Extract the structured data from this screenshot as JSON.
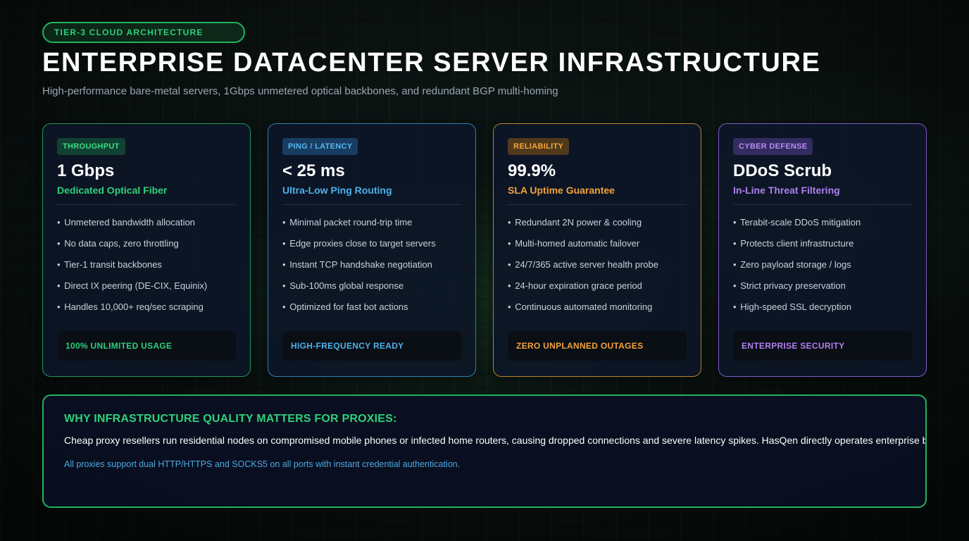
{
  "header": {
    "tag": "TIER-3 CLOUD ARCHITECTURE",
    "title": "ENTERPRISE DATACENTER SERVER INFRASTRUCTURE",
    "subtitle": "High-performance bare-metal servers, 1Gbps unmetered optical backbones, and redundant BGP multi-homing"
  },
  "colors": {
    "green": "#2fd07a",
    "blue": "#4fb0ea",
    "orange": "#f2a33a",
    "purple": "#b17ff0",
    "card_bg": "#0c1628",
    "page_bg": "#0a1311"
  },
  "cards": [
    {
      "tag": "THROUGHPUT",
      "metric": "1 Gbps",
      "metric_sub": "Dedicated Optical Fiber",
      "bullets": [
        "Unmetered bandwidth allocation",
        "No data caps, zero throttling",
        "Tier-1 transit backbones",
        "Direct IX peering (DE-CIX, Equinix)",
        "Handles 10,000+ req/sec scraping"
      ],
      "footer": "100% UNLIMITED USAGE"
    },
    {
      "tag": "PING / LATENCY",
      "metric": "< 25 ms",
      "metric_sub": "Ultra-Low Ping Routing",
      "bullets": [
        "Minimal packet round-trip time",
        "Edge proxies close to target servers",
        "Instant TCP handshake negotiation",
        "Sub-100ms global response",
        "Optimized for fast bot actions"
      ],
      "footer": "HIGH-FREQUENCY READY"
    },
    {
      "tag": "RELIABILITY",
      "metric": "99.9%",
      "metric_sub": "SLA Uptime Guarantee",
      "bullets": [
        "Redundant 2N power & cooling",
        "Multi-homed automatic failover",
        "24/7/365 active server health probe",
        "24-hour expiration grace period",
        "Continuous automated monitoring"
      ],
      "footer": "ZERO UNPLANNED OUTAGES"
    },
    {
      "tag": "CYBER DEFENSE",
      "metric": "DDoS Scrub",
      "metric_sub": "In-Line Threat Filtering",
      "bullets": [
        "Terabit-scale DDoS mitigation",
        "Protects client infrastructure",
        "Zero payload storage / logs",
        "Strict privacy preservation",
        "High-speed SSL decryption"
      ],
      "footer": "ENTERPRISE SECURITY"
    }
  ],
  "why": {
    "title": "WHY INFRASTRUCTURE QUALITY MATTERS FOR PROXIES:",
    "body": "Cheap proxy resellers run residential nodes on compromised mobile phones or infected home routers, causing dropped connections and severe latency spikes. HasQen directly operates enterprise bare-metal",
    "note": "All proxies support dual HTTP/HTTPS and SOCKS5 on all ports with instant credential authentication."
  }
}
